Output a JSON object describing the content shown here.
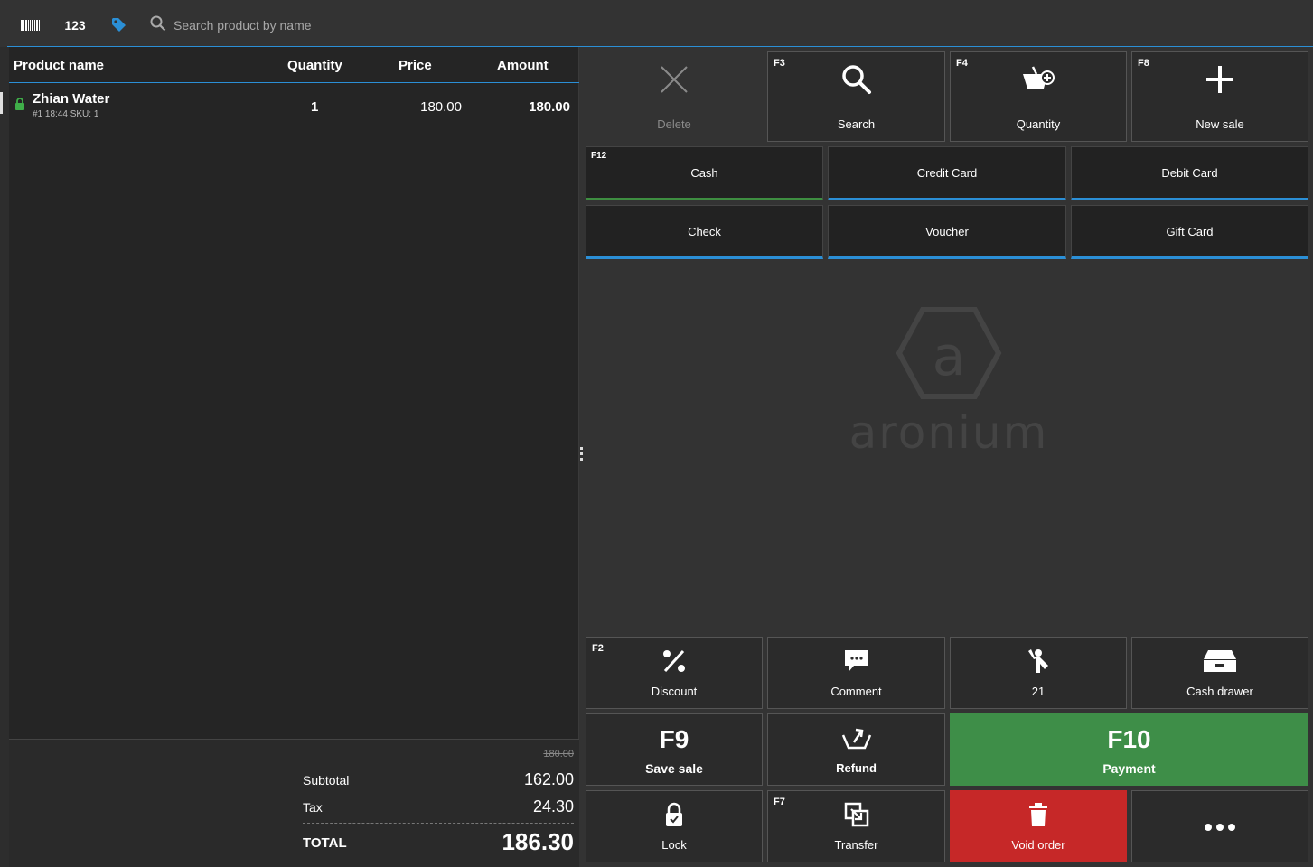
{
  "toolbar": {
    "barcode_icon": "barcode-icon",
    "number_label": "123",
    "tag_icon": "tag-icon",
    "search_placeholder": "Search product by name"
  },
  "table": {
    "headers": {
      "name": "Product name",
      "quantity": "Quantity",
      "price": "Price",
      "amount": "Amount"
    },
    "rows": [
      {
        "name": "Zhian Water",
        "meta": "#1 18:44 SKU: 1",
        "quantity": "1",
        "price": "180.00",
        "amount": "180.00"
      }
    ]
  },
  "totals": {
    "original": "180.00",
    "subtotal_label": "Subtotal",
    "subtotal": "162.00",
    "tax_label": "Tax",
    "tax": "24.30",
    "total_label": "TOTAL",
    "total": "186.30"
  },
  "actions": {
    "delete": {
      "label": "Delete"
    },
    "search": {
      "key": "F3",
      "label": "Search"
    },
    "quantity": {
      "key": "F4",
      "label": "Quantity"
    },
    "new_sale": {
      "key": "F8",
      "label": "New sale"
    }
  },
  "payments": {
    "cash": {
      "key": "F12",
      "label": "Cash"
    },
    "credit": {
      "label": "Credit Card"
    },
    "debit": {
      "label": "Debit Card"
    },
    "check": {
      "label": "Check"
    },
    "voucher": {
      "label": "Voucher"
    },
    "gift": {
      "label": "Gift Card"
    }
  },
  "logo": {
    "text": "aronium"
  },
  "bottom": {
    "discount": {
      "key": "F2",
      "label": "Discount"
    },
    "comment": {
      "label": "Comment"
    },
    "customer": {
      "label": "21"
    },
    "cash_drawer": {
      "label": "Cash drawer"
    },
    "save_sale": {
      "key": "F9",
      "label": "Save sale"
    },
    "refund": {
      "label": "Refund"
    },
    "payment": {
      "key": "F10",
      "label": "Payment"
    },
    "lock": {
      "label": "Lock"
    },
    "transfer": {
      "key": "F7",
      "label": "Transfer"
    },
    "void_order": {
      "label": "Void order"
    }
  },
  "colors": {
    "accent_blue": "#2b8fd6",
    "green": "#3e8e48",
    "red": "#c62828"
  }
}
